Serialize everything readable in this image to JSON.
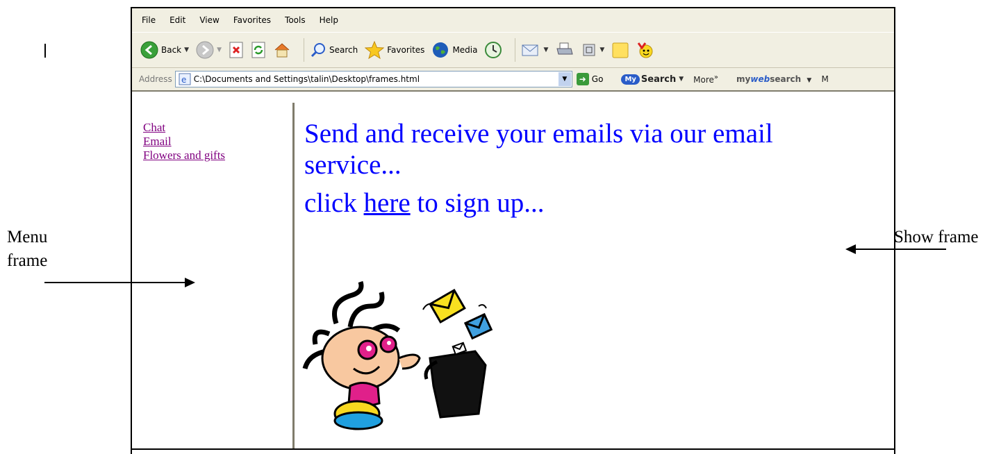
{
  "browser": {
    "menu": [
      "File",
      "Edit",
      "View",
      "Favorites",
      "Tools",
      "Help"
    ],
    "toolbar": {
      "back": "Back",
      "search": "Search",
      "favorites": "Favorites",
      "media": "Media"
    },
    "address": {
      "label": "Address",
      "value": "C:\\Documents and Settings\\talin\\Desktop\\frames.html",
      "go": "Go"
    },
    "mysearch": {
      "badge": "My",
      "label": "Search",
      "more": "More",
      "mywebsearch_prefix": "my",
      "mywebsearch_web": "web",
      "mywebsearch_suffix": "search",
      "trailing": "M"
    }
  },
  "menu_frame": {
    "links": [
      "Chat",
      "Email",
      "Flowers and gifts"
    ]
  },
  "show_frame": {
    "line1": "Send and receive your emails via our email",
    "line2": "service...",
    "line3_prefix": "click ",
    "line3_link": "here",
    "line3_suffix": " to sign up..."
  },
  "annotations": {
    "menu_frame_label_1": "Menu",
    "menu_frame_label_2": "frame",
    "show_frame_label": "Show frame"
  }
}
